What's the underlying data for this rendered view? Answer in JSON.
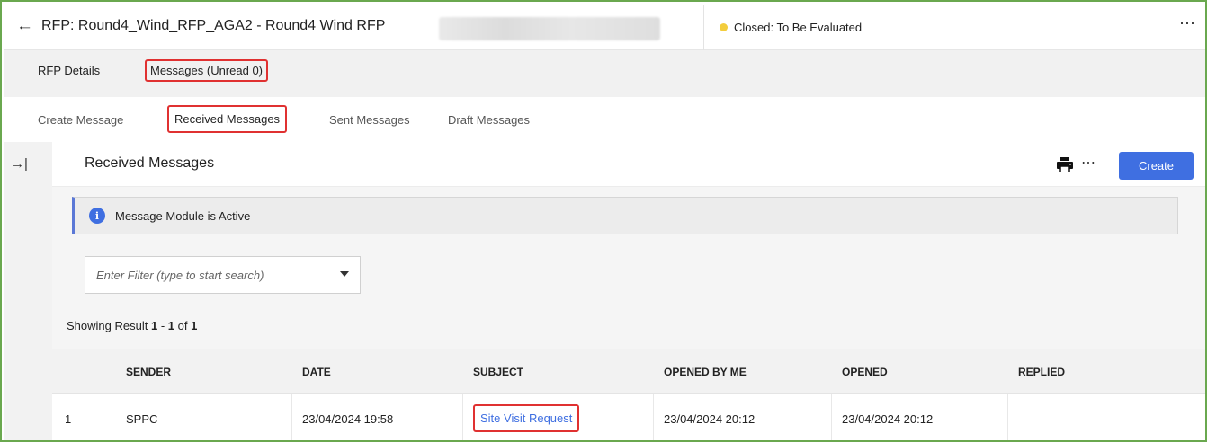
{
  "header": {
    "title": "RFP: Round4_Wind_RFP_AGA2 - Round4 Wind RFP",
    "status": "Closed: To Be Evaluated",
    "status_color": "#f3cd3d",
    "more": "⋯"
  },
  "main_tabs": [
    {
      "label": "RFP Details"
    },
    {
      "label": "Messages (Unread 0)"
    }
  ],
  "sub_tabs": [
    {
      "label": "Create Message"
    },
    {
      "label": "Received Messages"
    },
    {
      "label": "Sent Messages"
    },
    {
      "label": "Draft Messages"
    }
  ],
  "panel": {
    "title": "Received Messages",
    "create_label": "Create",
    "more": "⋯",
    "accent_color": "#3f6fe1"
  },
  "info": {
    "text": "Message Module is Active"
  },
  "filter": {
    "placeholder": "Enter Filter (type to start search)"
  },
  "results": {
    "prefix": "Showing Result",
    "from": "1",
    "dash": "-",
    "to": "1",
    "of_label": "of",
    "total": "1"
  },
  "table": {
    "columns": [
      "SENDER",
      "DATE",
      "SUBJECT",
      "OPENED BY ME",
      "OPENED",
      "REPLIED"
    ],
    "rows": [
      {
        "index": "1",
        "sender": "SPPC",
        "date": "23/04/2024 19:58",
        "subject": "Site Visit Request",
        "opened_by_me": "23/04/2024 20:12",
        "opened": "23/04/2024 20:12",
        "replied": ""
      }
    ]
  }
}
